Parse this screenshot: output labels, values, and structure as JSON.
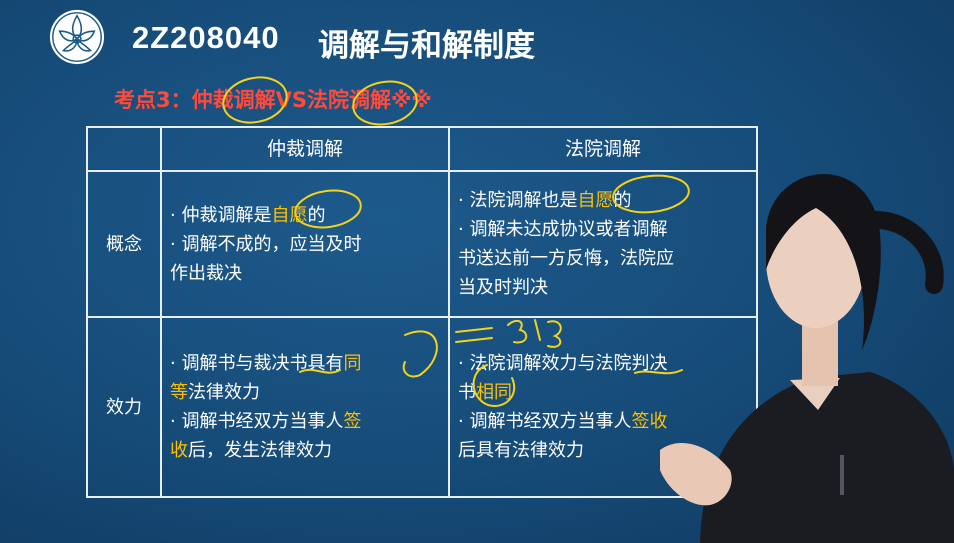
{
  "header": {
    "course_code": "2Z208040",
    "title": "调解与和解制度"
  },
  "subtitle": "考点3：仲裁调解VS法院调解※※",
  "table": {
    "columns": [
      "",
      "仲裁调解",
      "法院调解"
    ],
    "rows": [
      {
        "label": "概念",
        "arbitration": [
          [
            {
              "t": "· 仲裁调解是"
            },
            {
              "t": "自愿",
              "hl": true
            },
            {
              "t": "的"
            }
          ],
          [
            {
              "t": "· 调解不成的，应当及时"
            }
          ],
          [
            {
              "t": "作出裁决"
            }
          ]
        ],
        "court": [
          [
            {
              "t": "· 法院调解也是"
            },
            {
              "t": "自愿",
              "hl": true
            },
            {
              "t": "的"
            }
          ],
          [
            {
              "t": "· 调解未达成协议或者调解"
            }
          ],
          [
            {
              "t": "书送达前一方反悔，法院应"
            }
          ],
          [
            {
              "t": "当及时判决"
            }
          ]
        ]
      },
      {
        "label": "效力",
        "arbitration": [
          [
            {
              "t": "· 调解书与裁决书具有"
            },
            {
              "t": "同",
              "hl": true
            }
          ],
          [
            {
              "t": "等",
              "hl": true
            },
            {
              "t": "法律效力"
            }
          ],
          [
            {
              "t": "· 调解书经双方当事人"
            },
            {
              "t": "签",
              "hl": true
            }
          ],
          [
            {
              "t": "收",
              "hl": true
            },
            {
              "t": "后，发生法律效力"
            }
          ]
        ],
        "court": [
          [
            {
              "t": "· 法院调解效力与法院判决"
            }
          ],
          [
            {
              "t": "书"
            },
            {
              "t": "相同",
              "hl": true
            }
          ],
          [
            {
              "t": "· 调解书经双方当事人"
            },
            {
              "t": "签收",
              "hl": true
            }
          ],
          [
            {
              "t": "后具有法律效力"
            }
          ]
        ]
      }
    ]
  },
  "colors": {
    "background": "#164b78",
    "title": "#ffffff",
    "subtitle": "#ff4a3a",
    "highlight": "#ffc000",
    "table_border": "#e8eef5",
    "annotation_ink": "#f2d21a"
  },
  "icons": {
    "logo": "lotus-emblem-icon"
  }
}
